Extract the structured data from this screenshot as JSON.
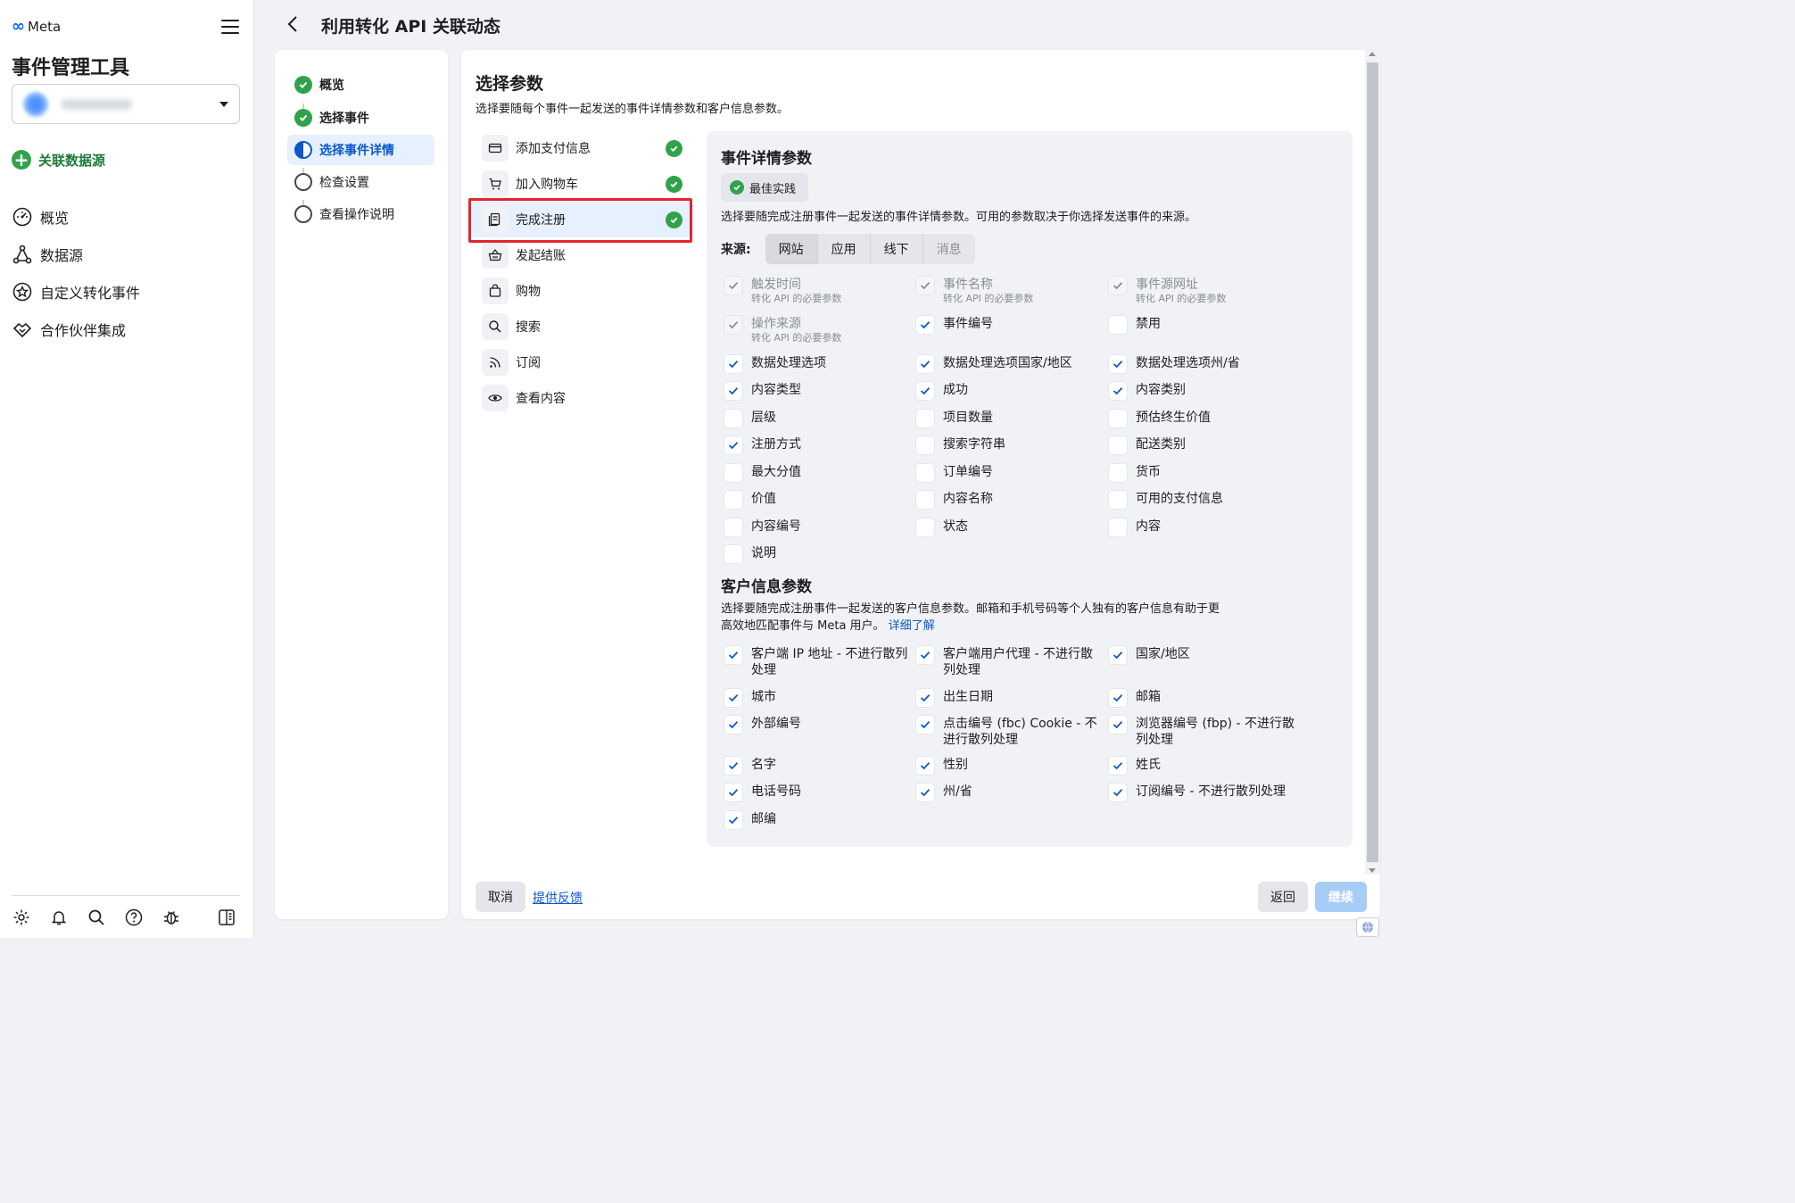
{
  "brand": {
    "logo_text": "Meta",
    "app_title": "事件管理工具"
  },
  "sidebar": {
    "connect_label": "关联数据源",
    "items": [
      {
        "label": "概览",
        "icon": "gauge-icon"
      },
      {
        "label": "数据源",
        "icon": "data-sources-icon"
      },
      {
        "label": "自定义转化事件",
        "icon": "star-badge-icon"
      },
      {
        "label": "合作伙伴集成",
        "icon": "handshake-icon"
      }
    ],
    "footer_icons": [
      "settings-icon",
      "notifications-icon",
      "search-icon",
      "help-icon",
      "bug-icon",
      "panel-toggle-icon"
    ]
  },
  "header": {
    "title": "利用转化 API 关联动态"
  },
  "steps": [
    {
      "label": "概览",
      "state": "done"
    },
    {
      "label": "选择事件",
      "state": "done"
    },
    {
      "label": "选择事件详情",
      "state": "active"
    },
    {
      "label": "检查设置",
      "state": "todo"
    },
    {
      "label": "查看操作说明",
      "state": "todo"
    }
  ],
  "main": {
    "title": "选择参数",
    "description": "选择要随每个事件一起发送的事件详情参数和客户信息参数。",
    "events": [
      {
        "label": "添加支付信息",
        "icon": "credit-card-icon",
        "checked": true
      },
      {
        "label": "加入购物车",
        "icon": "cart-icon",
        "checked": true
      },
      {
        "label": "完成注册",
        "icon": "registration-icon",
        "checked": true,
        "selected": true
      },
      {
        "label": "发起结账",
        "icon": "basket-icon",
        "checked": false
      },
      {
        "label": "购物",
        "icon": "shopping-bag-icon",
        "checked": false
      },
      {
        "label": "搜索",
        "icon": "search-icon",
        "checked": false
      },
      {
        "label": "订阅",
        "icon": "rss-icon",
        "checked": false
      },
      {
        "label": "查看内容",
        "icon": "eye-icon",
        "checked": false
      }
    ],
    "event_params": {
      "title": "事件详情参数",
      "best_practice": "最佳实践",
      "description": "选择要随完成注册事件一起发送的事件详情参数。可用的参数取决于你选择发送事件的来源。",
      "source_label": "来源:",
      "sources": [
        "网站",
        "应用",
        "线下",
        "消息"
      ],
      "active_source": "网站",
      "required_note": "转化 API 的必要参数",
      "items": [
        {
          "label": "触发时间",
          "checked": true,
          "disabled": true,
          "required": true
        },
        {
          "label": "事件名称",
          "checked": true,
          "disabled": true,
          "required": true
        },
        {
          "label": "事件源网址",
          "checked": true,
          "disabled": true,
          "required": true
        },
        {
          "label": "操作来源",
          "checked": true,
          "disabled": true,
          "required": true
        },
        {
          "label": "事件编号",
          "checked": true
        },
        {
          "label": "禁用",
          "checked": false
        },
        {
          "label": "数据处理选项",
          "checked": true
        },
        {
          "label": "数据处理选项国家/地区",
          "checked": true
        },
        {
          "label": "数据处理选项州/省",
          "checked": true
        },
        {
          "label": "内容类型",
          "checked": true
        },
        {
          "label": "成功",
          "checked": true
        },
        {
          "label": "内容类别",
          "checked": true
        },
        {
          "label": "层级",
          "checked": false
        },
        {
          "label": "项目数量",
          "checked": false
        },
        {
          "label": "预估终生价值",
          "checked": false
        },
        {
          "label": "注册方式",
          "checked": true
        },
        {
          "label": "搜索字符串",
          "checked": false
        },
        {
          "label": "配送类别",
          "checked": false
        },
        {
          "label": "最大分值",
          "checked": false
        },
        {
          "label": "订单编号",
          "checked": false
        },
        {
          "label": "货币",
          "checked": false
        },
        {
          "label": "价值",
          "checked": false
        },
        {
          "label": "内容名称",
          "checked": false
        },
        {
          "label": "可用的支付信息",
          "checked": false
        },
        {
          "label": "内容编号",
          "checked": false
        },
        {
          "label": "状态",
          "checked": false
        },
        {
          "label": "内容",
          "checked": false
        },
        {
          "label": "说明",
          "checked": false
        }
      ]
    },
    "customer_params": {
      "title": "客户信息参数",
      "description": "选择要随完成注册事件一起发送的客户信息参数。邮箱和手机号码等个人独有的客户信息有助于更高效地匹配事件与 Meta 用户。",
      "learn_more": "详细了解",
      "items": [
        {
          "label": "客户端 IP 地址 - 不进行散列处理",
          "checked": true
        },
        {
          "label": "客户端用户代理 - 不进行散列处理",
          "checked": true
        },
        {
          "label": "国家/地区",
          "checked": true
        },
        {
          "label": "城市",
          "checked": true
        },
        {
          "label": "出生日期",
          "checked": true
        },
        {
          "label": "邮箱",
          "checked": true
        },
        {
          "label": "外部编号",
          "checked": true
        },
        {
          "label": "点击编号 (fbc) Cookie - 不进行散列处理",
          "checked": true
        },
        {
          "label": "浏览器编号 (fbp) - 不进行散列处理",
          "checked": true
        },
        {
          "label": "名字",
          "checked": true
        },
        {
          "label": "性别",
          "checked": true
        },
        {
          "label": "姓氏",
          "checked": true
        },
        {
          "label": "电话号码",
          "checked": true
        },
        {
          "label": "州/省",
          "checked": true
        },
        {
          "label": "订阅编号 - 不进行散列处理",
          "checked": true
        },
        {
          "label": "邮编",
          "checked": true
        }
      ]
    },
    "footer": {
      "cancel": "取消",
      "feedback": "提供反馈",
      "back": "返回",
      "continue": "继续"
    }
  },
  "colors": {
    "accent": "#0a58ca",
    "success": "#31a24c",
    "highlight": "#e1262d"
  }
}
